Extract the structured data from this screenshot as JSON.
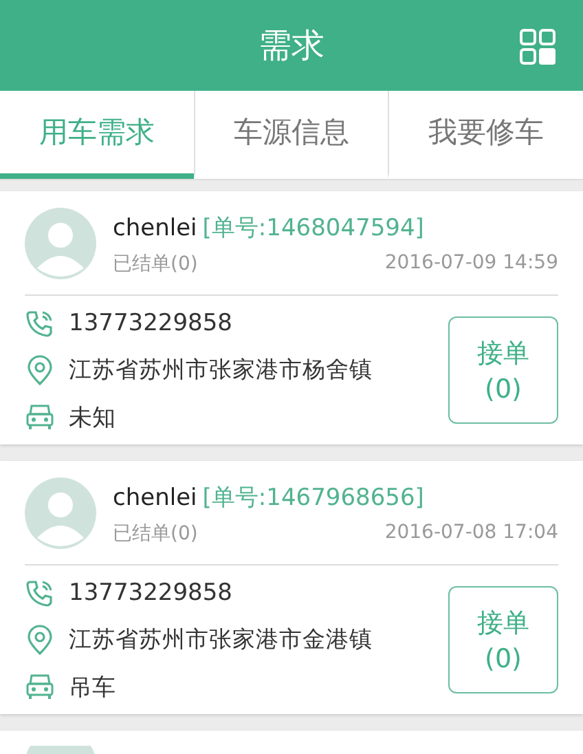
{
  "header": {
    "title": "需求"
  },
  "tabs": [
    {
      "label": "用车需求",
      "selected": true
    },
    {
      "label": "车源信息",
      "selected": false
    },
    {
      "label": "我要修车",
      "selected": false
    }
  ],
  "orders": [
    {
      "name": "chenlei",
      "order_no": "[单号:1468047594]",
      "completed": "已结单(0)",
      "time": "2016-07-09 14:59",
      "phone": "13773229858",
      "address": "江苏省苏州市张家港市杨舍镇",
      "vehicle": "未知",
      "button": {
        "label": "接单",
        "count": "(0)"
      }
    },
    {
      "name": "chenlei",
      "order_no": "[单号:1467968656]",
      "completed": "已结单(0)",
      "time": "2016-07-08 17:04",
      "phone": "13773229858",
      "address": "江苏省苏州市张家港市金港镇",
      "vehicle": "吊车",
      "button": {
        "label": "接单",
        "count": "(0)"
      }
    }
  ]
}
